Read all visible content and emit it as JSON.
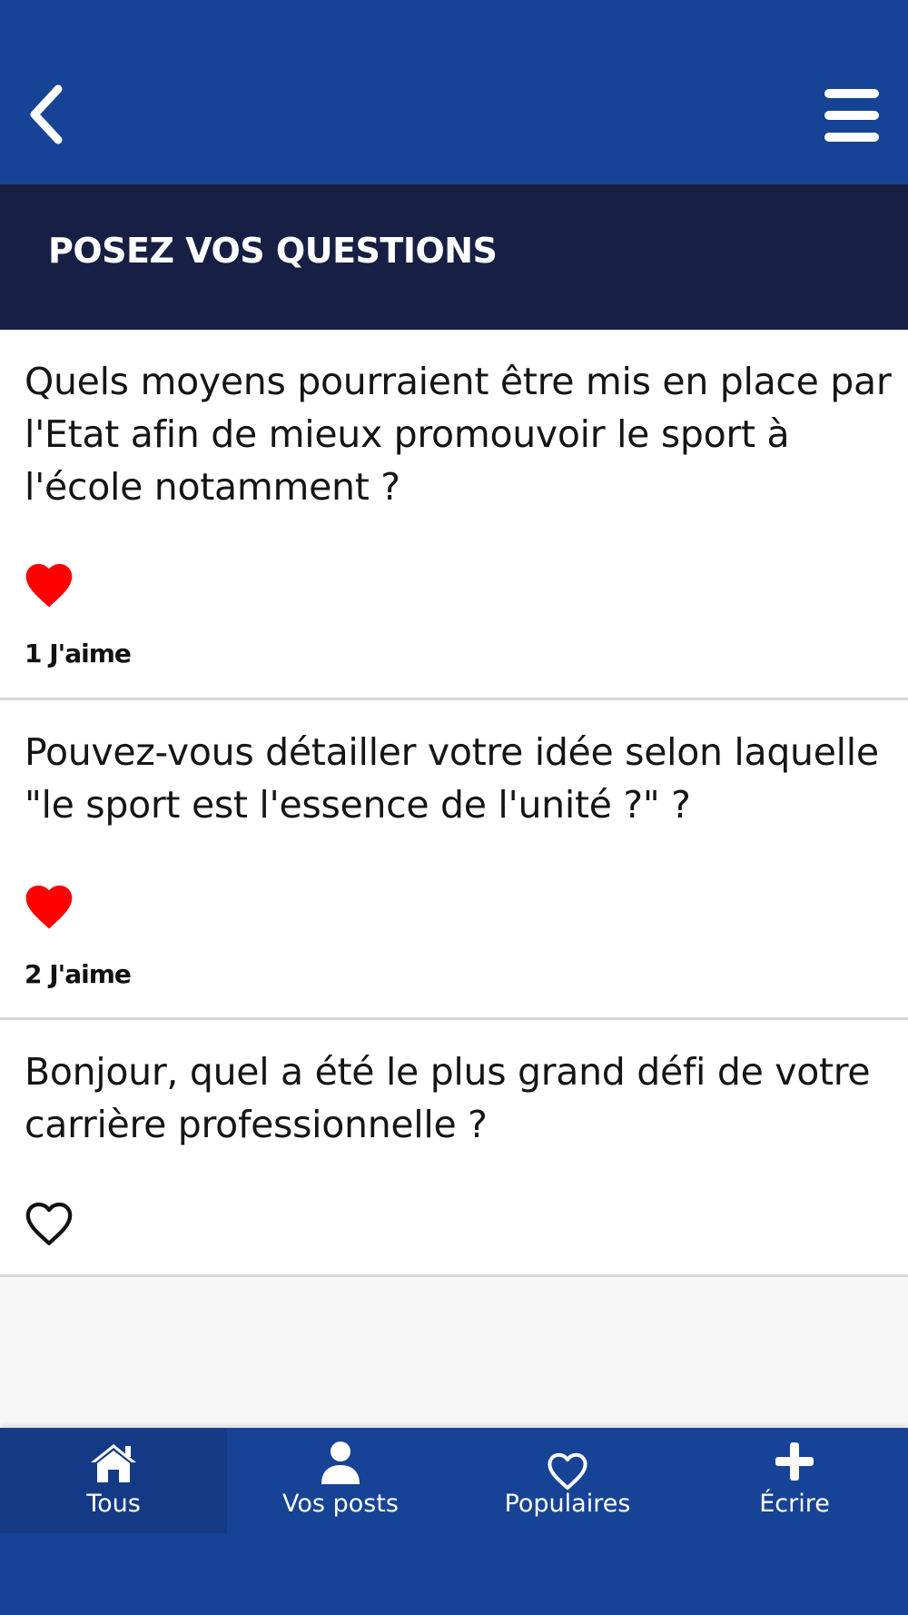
{
  "header": {
    "back_icon": "chevron-left-icon",
    "menu_icon": "hamburger-menu-icon"
  },
  "section": {
    "title": "POSEZ VOS QUESTIONS"
  },
  "posts": [
    {
      "text": "Quels moyens pourraient être mis en place par l'Etat afin de mieux promouvoir le sport à l'école notamment ?",
      "liked": true,
      "likes_label": "1 J'aime"
    },
    {
      "text": "Pouvez-vous détailler votre idée selon laquelle \"le sport est l'essence de l'unité ?\" ?",
      "liked": true,
      "likes_label": "2 J'aime"
    },
    {
      "text": "Bonjour, quel a été le plus grand défi de votre carrière professionnelle ?",
      "liked": false,
      "likes_label": ""
    }
  ],
  "bottom_nav": {
    "items": [
      {
        "label": "Tous",
        "icon": "home-icon",
        "active": true
      },
      {
        "label": "Vos posts",
        "icon": "user-icon",
        "active": false
      },
      {
        "label": "Populaires",
        "icon": "heart-outline-icon",
        "active": false
      },
      {
        "label": "Écrire",
        "icon": "plus-icon",
        "active": false
      }
    ]
  },
  "colors": {
    "primary_blue": "#174396",
    "section_navy": "#171f44",
    "like_red": "#ff0000",
    "background": "#f7f7f7"
  }
}
